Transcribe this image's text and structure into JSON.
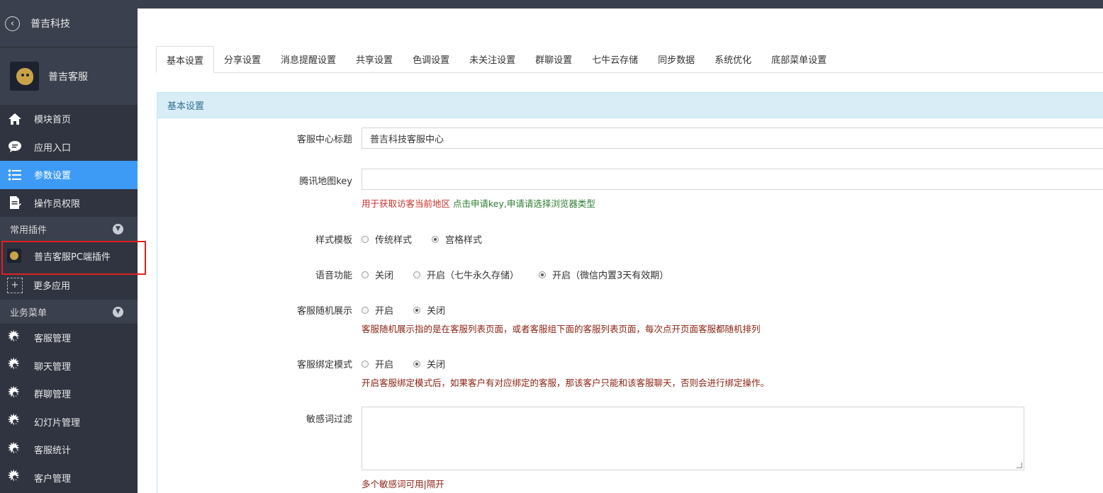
{
  "sidebar": {
    "org": "普吉科技",
    "app_name": "普吉客服",
    "nav": [
      {
        "label": "模块首页",
        "icon": "home-icon"
      },
      {
        "label": "应用入口",
        "icon": "chat-bubble-icon"
      },
      {
        "label": "参数设置",
        "icon": "list-icon",
        "active": true
      },
      {
        "label": "操作员权限",
        "icon": "document-edit-icon"
      }
    ],
    "plugins_section": "常用插件",
    "plugin_item": "普吉客服PC端插件",
    "more_apps": "更多应用",
    "business_section": "业务菜单",
    "business_items": [
      "客服管理",
      "聊天管理",
      "群聊管理",
      "幻灯片管理",
      "客服统计",
      "客户管理"
    ]
  },
  "tabs": [
    "基本设置",
    "分享设置",
    "消息提醒设置",
    "共享设置",
    "色调设置",
    "未关注设置",
    "群聊设置",
    "七牛云存储",
    "同步数据",
    "系统优化",
    "底部菜单设置"
  ],
  "panel_title": "基本设置",
  "form": {
    "title_label": "客服中心标题",
    "title_value": "普吉科技客服中心",
    "map_label": "腾讯地图key",
    "map_value": "",
    "map_help_red": "用于获取访客当前地区",
    "map_help_green": "点击申请key,申请请选择浏览器类型",
    "style_label": "样式模板",
    "style_options": [
      "传统样式",
      "宫格样式"
    ],
    "style_selected": 1,
    "voice_label": "语音功能",
    "voice_options": [
      "关闭",
      "开启（七牛永久存储）",
      "开启（微信内置3天有效期）"
    ],
    "voice_selected": 2,
    "random_label": "客服随机展示",
    "random_options": [
      "开启",
      "关闭"
    ],
    "random_selected": 1,
    "random_help": "客服随机展示指的是在客服列表页面，或者客服组下面的客服列表页面，每次点开页面客服都随机排列",
    "bind_label": "客服绑定模式",
    "bind_options": [
      "开启",
      "关闭"
    ],
    "bind_selected": 1,
    "bind_help": "开启客服绑定模式后，如果客户有对应绑定的客服，那该客户只能和该客服聊天，否则会进行绑定操作。",
    "filter_label": "敏感词过滤",
    "filter_value": "",
    "filter_help": "多个敏感词可用|隔开"
  }
}
